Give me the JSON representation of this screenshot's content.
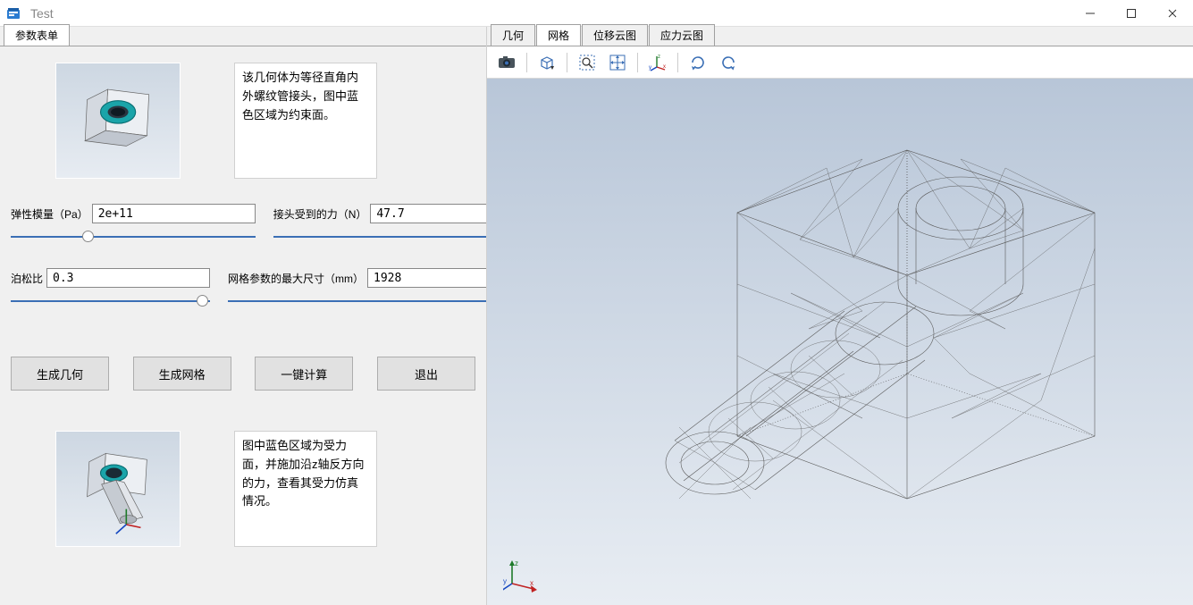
{
  "window": {
    "title": "Test"
  },
  "left": {
    "tab_label": "参数表单",
    "thumb1": "pipe-fitting-constraint",
    "desc1": "该几何体为等径直角内外螺纹管接头，图中蓝色区域为约束面。",
    "thumb2": "pipe-fitting-force",
    "desc2": "图中蓝色区域为受力面，并施加沿z轴反方向的力，查看其受力仿真情况。",
    "params": {
      "modulus_label": "弹性模量（Pa）",
      "modulus_value": "2e+11",
      "force_label": "接头受到的力（N）",
      "force_value": "47.7",
      "poisson_label": "泊松比",
      "poisson_value": "0.3",
      "mesh_label": "网格参数的最大尺寸（mm）",
      "mesh_value": "1928"
    },
    "buttons": {
      "gen_geom": "生成几何",
      "gen_mesh": "生成网格",
      "compute": "一键计算",
      "exit": "退出"
    }
  },
  "right": {
    "tabs": {
      "geom": "几何",
      "mesh": "网格",
      "disp": "位移云图",
      "stress": "应力云图"
    },
    "active_tab": "mesh"
  }
}
